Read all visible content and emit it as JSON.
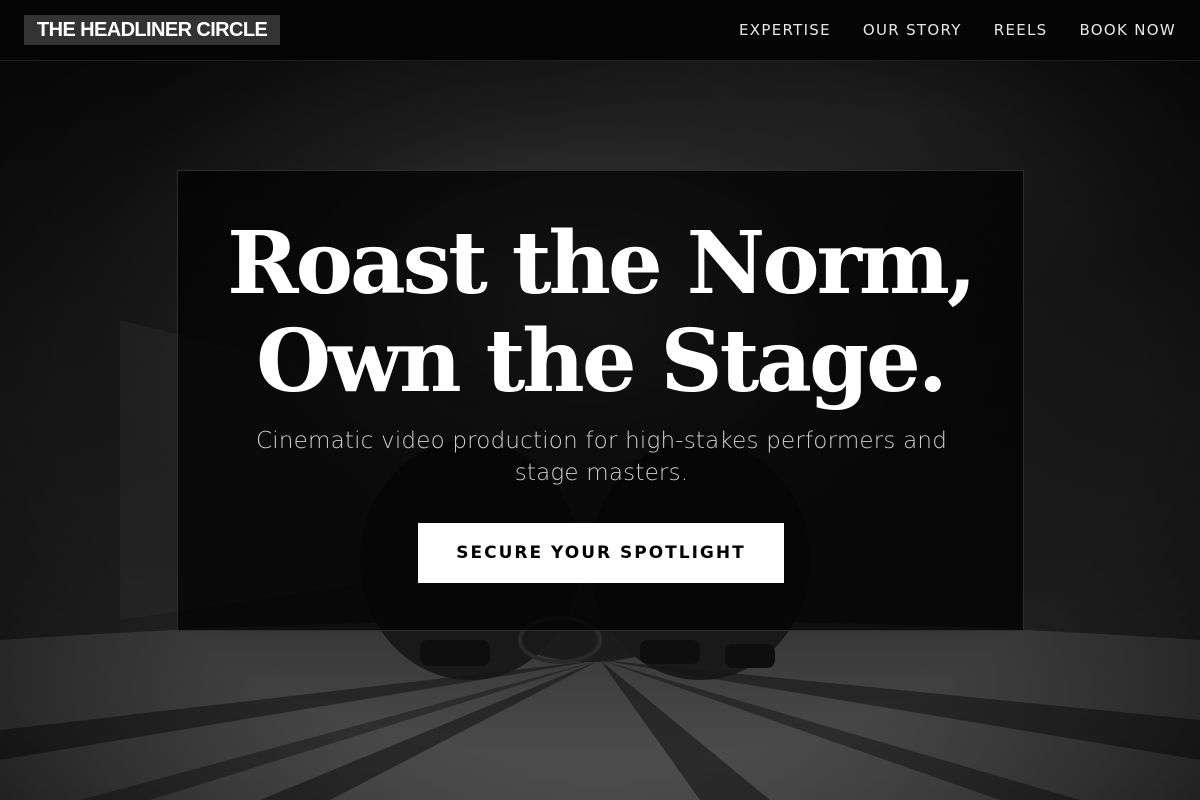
{
  "header": {
    "brand": "THE HEADLINER CIRCLE",
    "nav": [
      {
        "label": "EXPERTISE"
      },
      {
        "label": "OUR STORY"
      },
      {
        "label": "REELS"
      },
      {
        "label": "BOOK NOW"
      }
    ]
  },
  "hero": {
    "title_line_1": "Roast the Norm,",
    "title_line_2": "Own the Stage.",
    "subtitle": "Cinematic video production for high-stakes performers and stage masters.",
    "cta_label": "SECURE YOUR SPOTLIGHT"
  },
  "colors": {
    "nav_background": "#050505",
    "brand_background": "#333333",
    "cta_background": "#ffffff",
    "cta_text": "#000000",
    "text_primary": "#ffffff"
  }
}
